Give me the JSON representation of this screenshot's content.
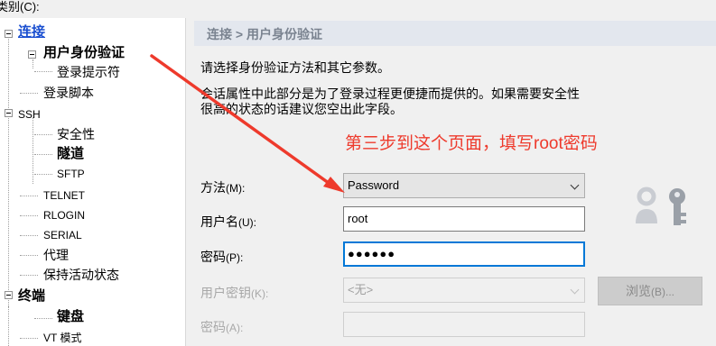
{
  "category_label": "类别(C):",
  "tree": {
    "items": [
      {
        "label": "连接"
      },
      {
        "label": "用户身份验证"
      },
      {
        "label": "登录提示符"
      },
      {
        "label": "登录脚本"
      },
      {
        "label": "SSH"
      },
      {
        "label": "安全性"
      },
      {
        "label": "隧道"
      },
      {
        "label": "SFTP"
      },
      {
        "label": "TELNET"
      },
      {
        "label": "RLOGIN"
      },
      {
        "label": "SERIAL"
      },
      {
        "label": "代理"
      },
      {
        "label": "保持活动状态"
      },
      {
        "label": "终端"
      },
      {
        "label": "键盘"
      },
      {
        "label": "VT 模式"
      }
    ]
  },
  "breadcrumb": "连接 > 用户身份验证",
  "description": {
    "line1": "请选择身份验证方法和其它参数。",
    "line2": "会话属性中此部分是为了登录过程更便捷而提供的。如果需要安全性",
    "line3": "很高的状态的话建议您空出此字段。"
  },
  "annotation": "第三步到这个页面，填写root密码",
  "form": {
    "method": {
      "label": "方法",
      "accel": "(M):",
      "value": "Password"
    },
    "username": {
      "label": "用户名",
      "accel": "(U):",
      "value": "root"
    },
    "password": {
      "label": "密码",
      "accel": "(P):",
      "value": "●●●●●●"
    },
    "user_key": {
      "label": "用户密钥",
      "accel": "(K):",
      "value": "<无>"
    },
    "passphrase": {
      "label": "密码",
      "accel": "(A):",
      "value": ""
    }
  },
  "browse_button": {
    "label": "浏览",
    "accel": "(B)..."
  },
  "icons": {
    "key": "key-icon",
    "expander": "tree-expander-icon"
  },
  "colors": {
    "selected_link": "#1a4fd0",
    "annotation": "#ee3a2c",
    "focus": "#0078d7"
  }
}
